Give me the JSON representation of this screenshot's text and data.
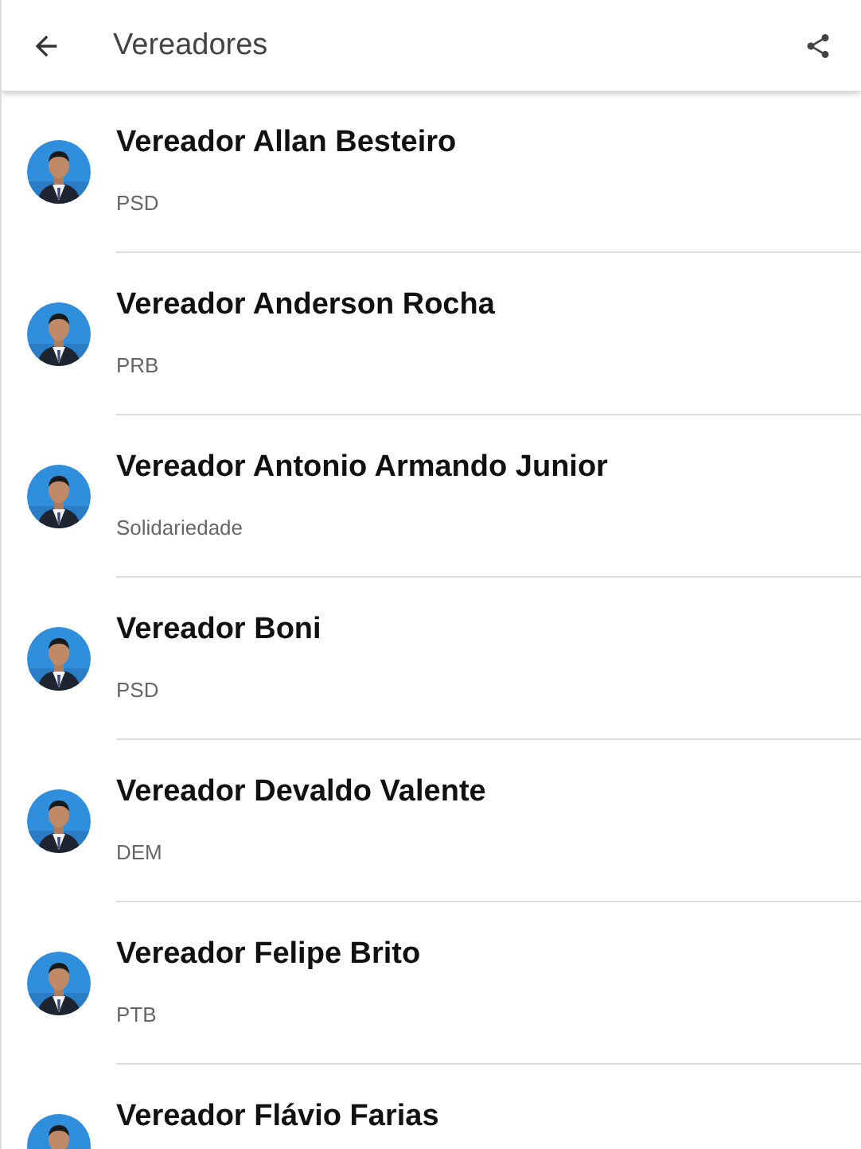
{
  "app_bar": {
    "title": "Vereadores"
  },
  "members": [
    {
      "name": "Vereador Allan Besteiro",
      "party": "PSD"
    },
    {
      "name": "Vereador Anderson Rocha",
      "party": "PRB"
    },
    {
      "name": "Vereador Antonio Armando Junior",
      "party": "Solidariedade"
    },
    {
      "name": "Vereador Boni",
      "party": "PSD"
    },
    {
      "name": "Vereador Devaldo Valente",
      "party": "DEM"
    },
    {
      "name": "Vereador Felipe Brito",
      "party": "PTB"
    },
    {
      "name": "Vereador Flávio Farias"
    }
  ]
}
